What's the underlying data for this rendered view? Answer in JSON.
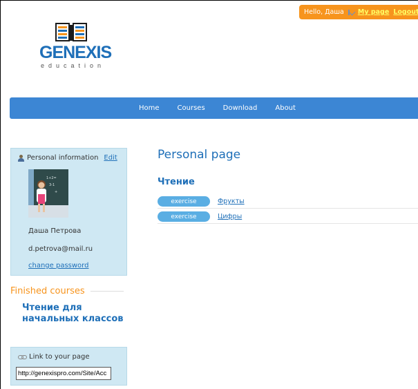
{
  "userbar": {
    "greeting": "Hello, Даша",
    "my_page": "My page",
    "logout": "Logout"
  },
  "logo": {
    "name": "GENEXIS",
    "sub": "education"
  },
  "nav": {
    "items": [
      "Home",
      "Courses",
      "Download",
      "About"
    ]
  },
  "personal": {
    "heading": "Personal information",
    "edit": "Edit",
    "name": "Даша Петрова",
    "email": "d.petrova@mail.ru",
    "change_password": "change password"
  },
  "finished": {
    "heading": "Finished courses",
    "course": "Чтение для начальных классов"
  },
  "link": {
    "heading": "Link to your page",
    "value": "http://genexispro.com/Site/Acc"
  },
  "main": {
    "title": "Personal page",
    "section": "Чтение",
    "rows": [
      {
        "badge": "exercise",
        "link": "Фрукты"
      },
      {
        "badge": "exercise",
        "link": "Цифры"
      }
    ]
  },
  "colors": {
    "accent": "#1e6fb8",
    "nav": "#3c86d4",
    "orange": "#f7941d",
    "sidebar": "#cfe8f3",
    "pill": "#5aaee3"
  }
}
